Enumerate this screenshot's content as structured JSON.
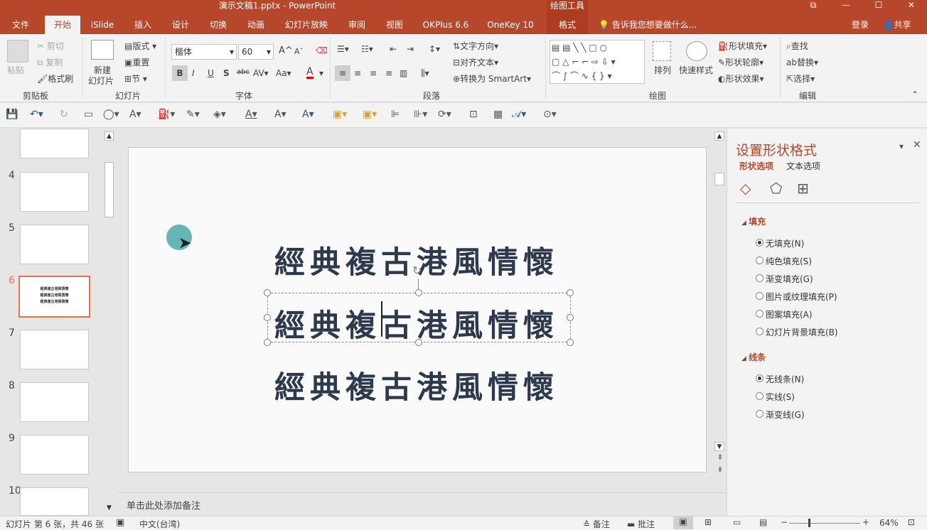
{
  "titlebar": {
    "title": "演示文稿1.pptx - PowerPoint",
    "tool": "绘图工具",
    "btn_restore": "⧉",
    "btn_min": "—",
    "btn_max": "☐",
    "btn_close": "✕"
  },
  "tabs": [
    "文件",
    "开始",
    "iSlide",
    "插入",
    "设计",
    "切换",
    "动画",
    "幻灯片放映",
    "审阅",
    "视图",
    "OKPlus 6.6",
    "OneKey 10",
    "格式"
  ],
  "tell": "告诉我您想要做什么...",
  "account": {
    "login": "登录",
    "share": "共享"
  },
  "ribbon": {
    "clipboard": {
      "paste": "粘贴",
      "cut": "剪切",
      "copy": "复制",
      "painter": "格式刷",
      "label": "剪贴板"
    },
    "slides": {
      "new": "新建",
      "new2": "幻灯片",
      "layout": "版式",
      "reset": "重置",
      "section": "节",
      "label": "幻灯片"
    },
    "font": {
      "name": "楷体",
      "size": "60",
      "label": "字体",
      "bold": "B",
      "italic": "I",
      "underline": "U",
      "shadow": "S",
      "strike": "abc",
      "spacing": "AV",
      "case": "Aa",
      "color": "A",
      "grow": "A",
      "shrink": "A"
    },
    "paragraph": {
      "direction": "文字方向",
      "align": "对齐文本",
      "smartart": "转换为 SmartArt",
      "label": "段落"
    },
    "drawing": {
      "arrange": "排列",
      "quick": "快速样式",
      "fill": "形状填充",
      "outline": "形状轮廓",
      "effect": "形状效果",
      "label": "绘图"
    },
    "editing": {
      "find": "查找",
      "replace": "替换",
      "select": "选择",
      "label": "编辑"
    }
  },
  "thumbs": {
    "numbers": [
      "4",
      "5",
      "6",
      "7",
      "8",
      "9",
      "10"
    ],
    "selected_lines": [
      "經典複古港風情懷",
      "經典複古港風情懷",
      "經典複古港風情懷"
    ]
  },
  "slide": {
    "lines": [
      "經典複古港風情懷",
      "經典複古港風情懷",
      "經典複古港風情懷"
    ]
  },
  "notes": "单击此处添加备注",
  "pane": {
    "title": "设置形状格式",
    "tab1": "形状选项",
    "tab2": "文本选项",
    "fill_header": "填充",
    "fill_options": [
      "无填充(N)",
      "纯色填充(S)",
      "渐变填充(G)",
      "图片或纹理填充(P)",
      "图案填充(A)",
      "幻灯片背景填充(B)"
    ],
    "line_header": "线条",
    "line_options": [
      "无线条(N)",
      "实线(S)",
      "渐变线(G)"
    ]
  },
  "status": {
    "slide_info": "幻灯片 第 6 张，共 46 张",
    "lang": "中文(台湾)",
    "notes": "备注",
    "comments": "批注",
    "zoom": "64%"
  },
  "colors": {
    "accent": "#b7472a",
    "selected_thumb": "#e8724f",
    "text": "#2d3a4e"
  }
}
